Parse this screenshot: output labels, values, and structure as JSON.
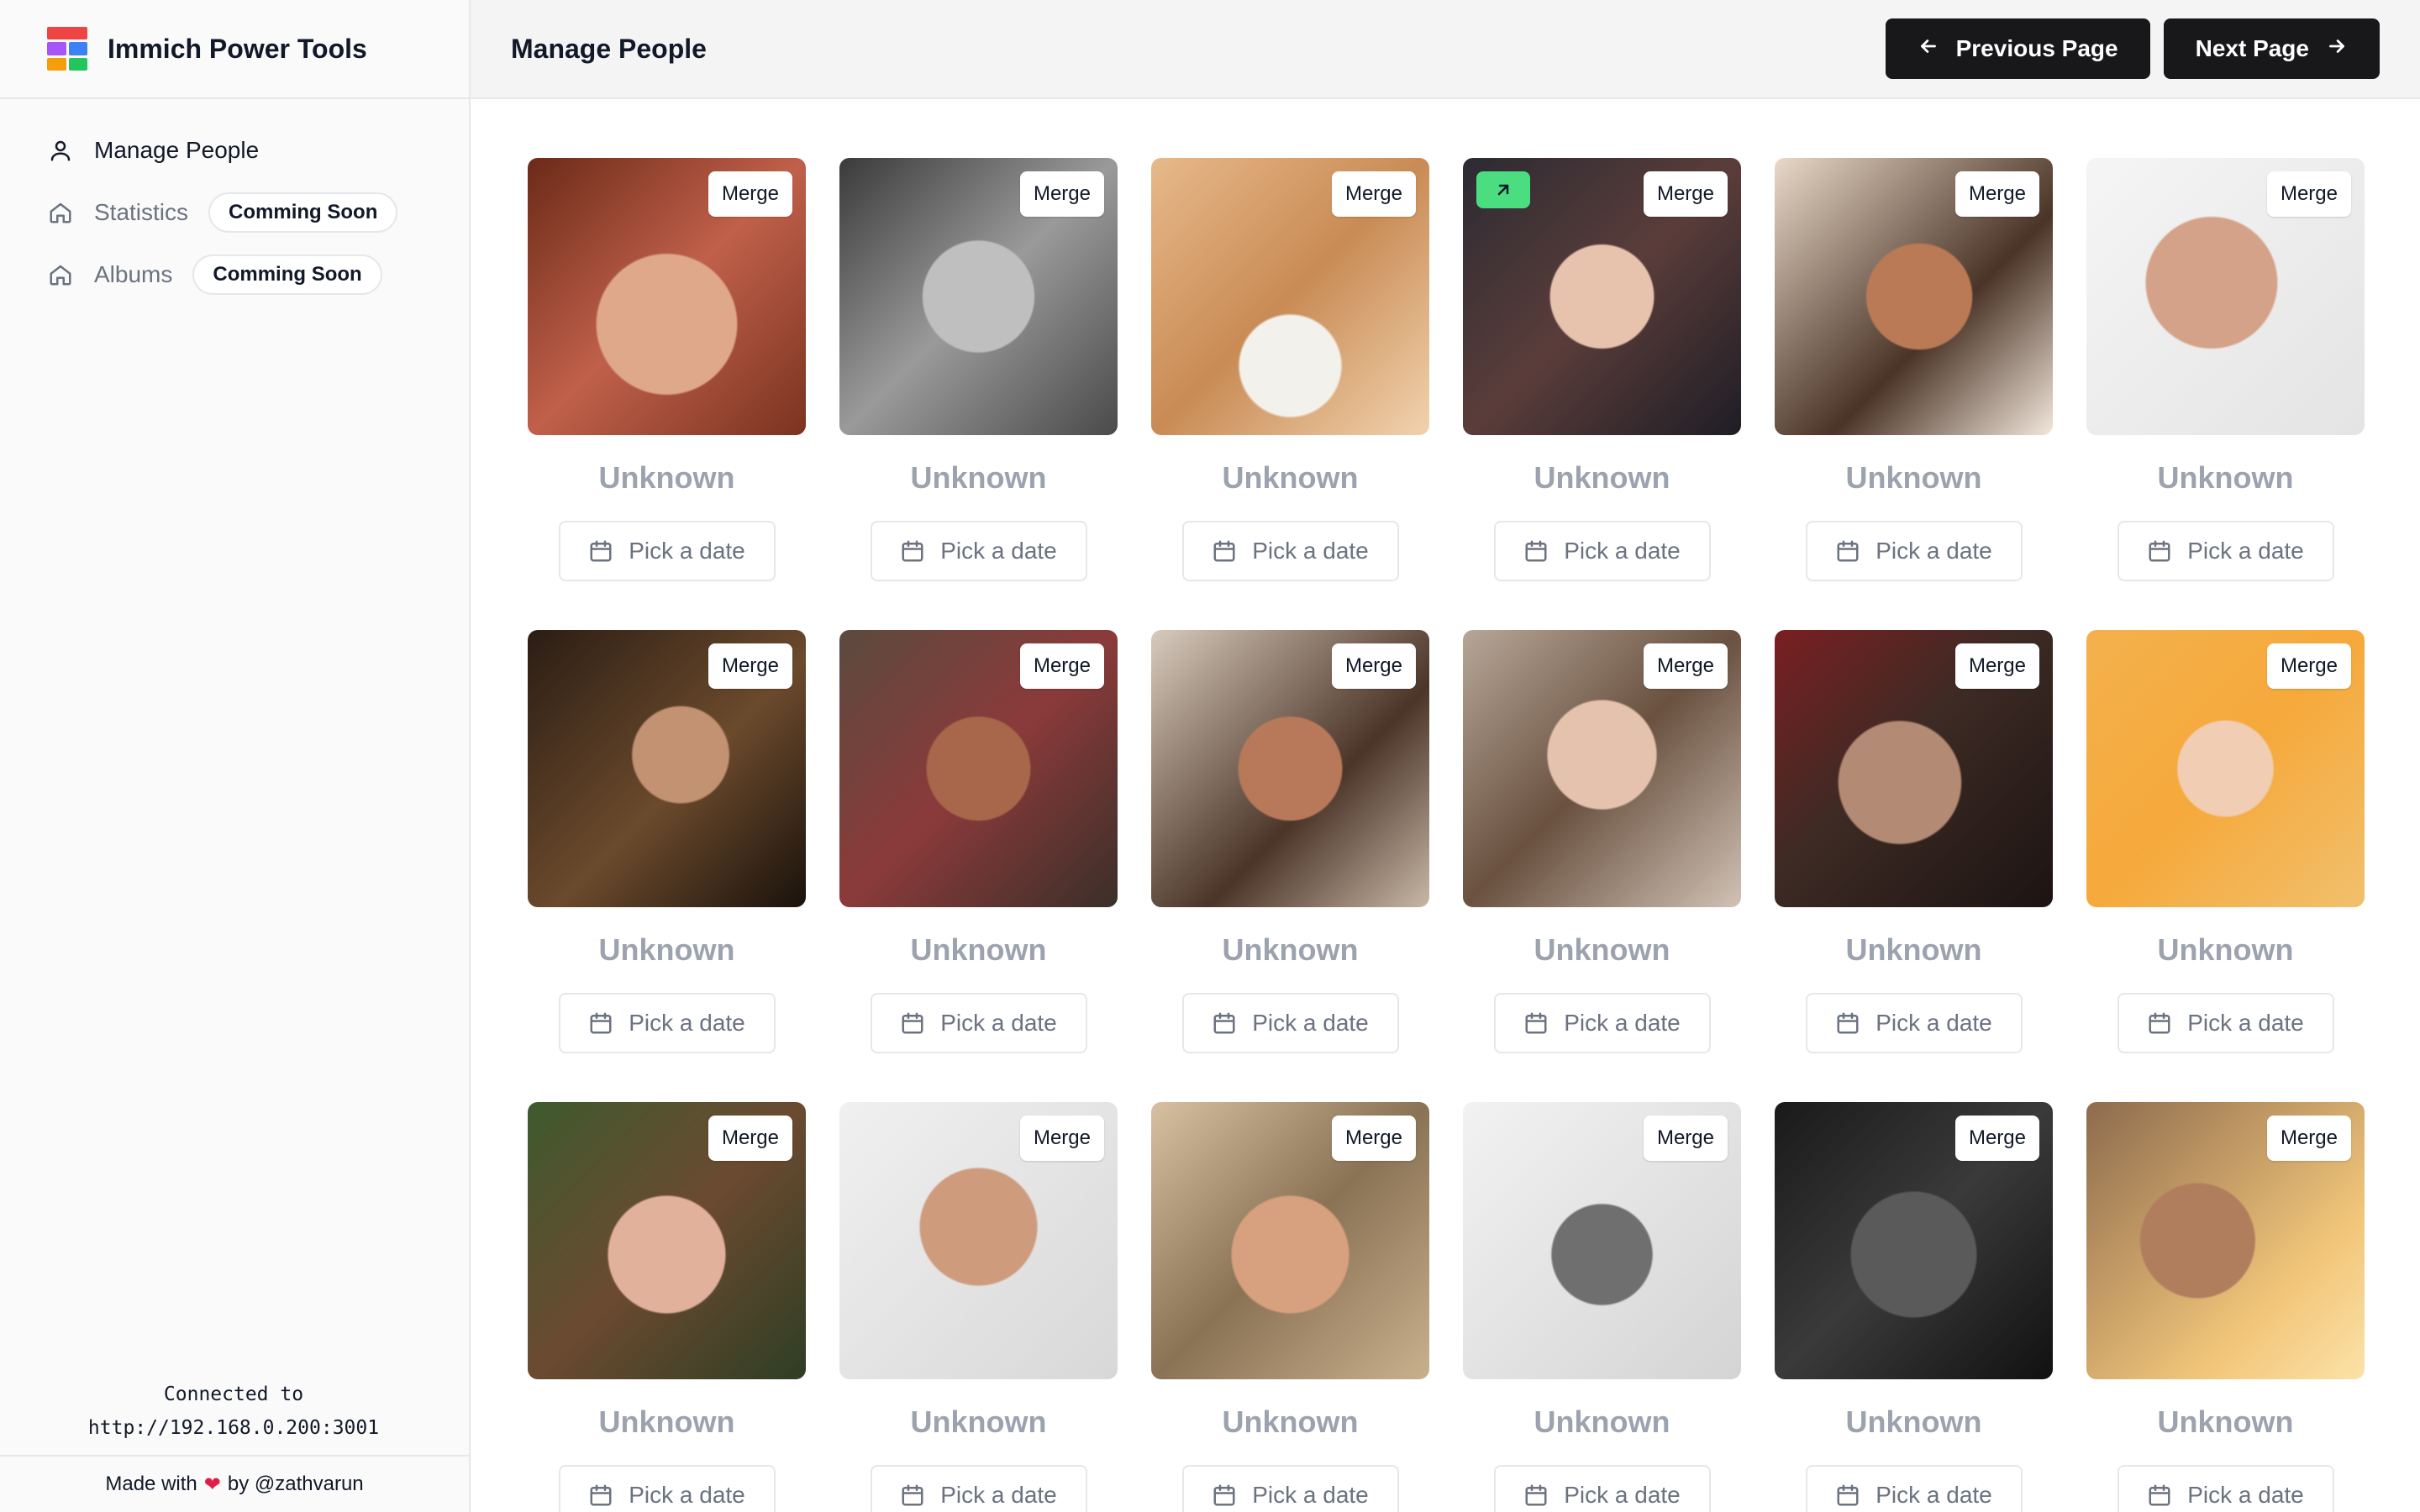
{
  "app": {
    "title": "Immich Power Tools",
    "logo_colors": [
      "#ef4444",
      "#a855f7",
      "#3b82f6",
      "#f59e0b",
      "#22c55e"
    ]
  },
  "sidebar": {
    "items": [
      {
        "label": "Manage People",
        "icon": "user-icon",
        "active": true
      },
      {
        "label": "Statistics",
        "icon": "home-icon",
        "badge": "Comming Soon"
      },
      {
        "label": "Albums",
        "icon": "home-icon",
        "badge": "Comming Soon"
      }
    ],
    "connection": {
      "line1": "Connected to",
      "line2": "http://192.168.0.200:3001"
    },
    "footer": {
      "prefix": "Made with",
      "heart": "❤",
      "suffix": "by @zathvarun"
    }
  },
  "header": {
    "title": "Manage People",
    "prev_label": "Previous Page",
    "next_label": "Next Page"
  },
  "people": [
    {
      "name": "Unknown",
      "merge_label": "Merge",
      "date_label": "Pick a date"
    },
    {
      "name": "Unknown",
      "merge_label": "Merge",
      "date_label": "Pick a date"
    },
    {
      "name": "Unknown",
      "merge_label": "Merge",
      "date_label": "Pick a date"
    },
    {
      "name": "Unknown",
      "merge_label": "Merge",
      "date_label": "Pick a date",
      "has_open_link": true
    },
    {
      "name": "Unknown",
      "merge_label": "Merge",
      "date_label": "Pick a date"
    },
    {
      "name": "Unknown",
      "merge_label": "Merge",
      "date_label": "Pick a date"
    },
    {
      "name": "Unknown",
      "merge_label": "Merge",
      "date_label": "Pick a date"
    },
    {
      "name": "Unknown",
      "merge_label": "Merge",
      "date_label": "Pick a date"
    },
    {
      "name": "Unknown",
      "merge_label": "Merge",
      "date_label": "Pick a date"
    },
    {
      "name": "Unknown",
      "merge_label": "Merge",
      "date_label": "Pick a date"
    },
    {
      "name": "Unknown",
      "merge_label": "Merge",
      "date_label": "Pick a date"
    },
    {
      "name": "Unknown",
      "merge_label": "Merge",
      "date_label": "Pick a date"
    },
    {
      "name": "Unknown",
      "merge_label": "Merge",
      "date_label": "Pick a date"
    },
    {
      "name": "Unknown",
      "merge_label": "Merge",
      "date_label": "Pick a date"
    },
    {
      "name": "Unknown",
      "merge_label": "Merge",
      "date_label": "Pick a date"
    },
    {
      "name": "Unknown",
      "merge_label": "Merge",
      "date_label": "Pick a date"
    },
    {
      "name": "Unknown",
      "merge_label": "Merge",
      "date_label": "Pick a date"
    },
    {
      "name": "Unknown",
      "merge_label": "Merge",
      "date_label": "Pick a date"
    }
  ]
}
